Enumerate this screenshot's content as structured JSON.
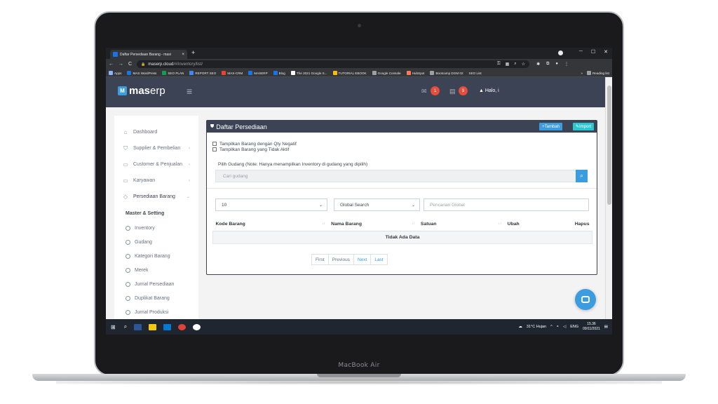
{
  "device": {
    "label": "MacBook Air"
  },
  "browser": {
    "tab_title": "Daftar Persediaan Barang - masi",
    "tab_close": "×",
    "new_tab": "+",
    "url_host": "maserp.cloud",
    "url_path": "/#/inventory/list/",
    "bookmarks": [
      "Apps",
      "MAS WordPress",
      "SEO PLAN",
      "REPORT SEO",
      "MAS-CRM",
      "MASERP",
      "Blog",
      "The 2021 Google S...",
      "TUTORIAL EBOOK",
      "Google Console",
      "HubSpot",
      "Bootcamp DGM 02",
      "SEO List"
    ],
    "bookmark_more": "»",
    "reading_list": "Reading list"
  },
  "app": {
    "logo_a": "mas",
    "logo_b": "erp",
    "logo_mark": "M",
    "mail_badge": "1",
    "calendar_badge": "9",
    "user_greeting": "Halo, i"
  },
  "sidebar": {
    "items": [
      {
        "label": "Dashboard",
        "icon": "home-icon"
      },
      {
        "label": "Supplier & Pembelian",
        "icon": "cart-icon"
      },
      {
        "label": "Customer & Penjualan",
        "icon": "card-icon"
      },
      {
        "label": "Karyawan",
        "icon": "id-card-icon"
      },
      {
        "label": "Persediaan Barang",
        "icon": "tag-icon"
      }
    ],
    "section": "Master & Setting",
    "subitems": [
      "Inventory",
      "Gudang",
      "Kategori Barang",
      "Merek",
      "Jurnal Persediaan",
      "Duplikat Barang",
      "Jurnal Produksi"
    ]
  },
  "panel": {
    "title": "Daftar Persediaan",
    "btn_add": "+Tambah",
    "btn_import": "Import",
    "check_negative": "Tampilkan Barang dengan Qty Negatif",
    "check_inactive": "Tampilkan Barang yang Tidak Aktif",
    "gudang_label": "Pilih Gudang (Note: Hanya menampilkan Inventory di gudang yang dipilih)",
    "gudang_placeholder": "Cari gudang",
    "page_size": "10",
    "search_mode": "Global Search",
    "search_placeholder": "Pencarian Global",
    "columns": [
      "Kode Barang",
      "Nama Barang",
      "Satuan",
      "Ubah",
      "Hapus"
    ],
    "empty": "Tidak Ada Data",
    "pager": [
      "First",
      "Previous",
      "Next",
      "Last"
    ]
  },
  "taskbar": {
    "weather": "31°C Hujan",
    "lang": "ENG",
    "time": "15.36",
    "date": "09/11/2021"
  },
  "colors": {
    "nav_dark": "#3b4354",
    "accent_blue": "#3b9de0",
    "accent_cyan": "#2bc7d1",
    "badge_red": "#e74c3c"
  }
}
